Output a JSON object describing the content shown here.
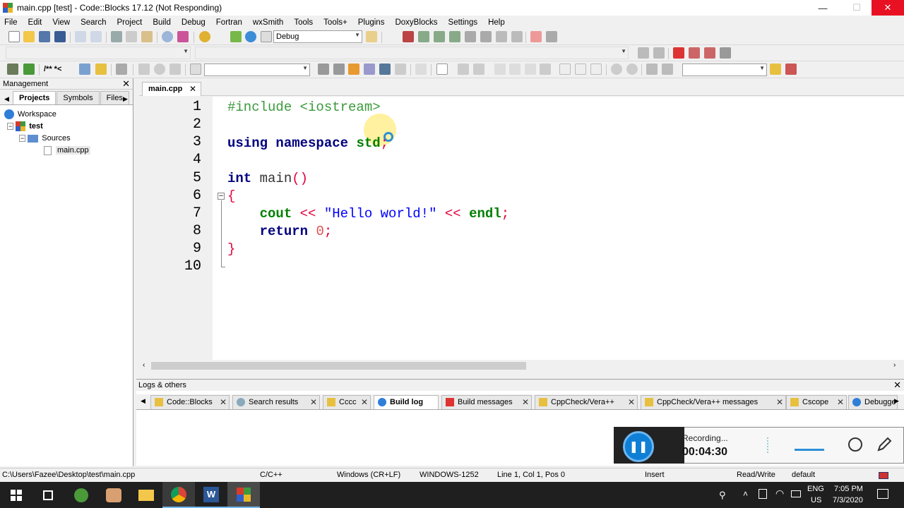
{
  "window": {
    "title": "main.cpp [test] - Code::Blocks 17.12 (Not Responding)",
    "minimize": "—",
    "maximize": "☐",
    "close": "✕"
  },
  "menu": [
    "File",
    "Edit",
    "View",
    "Search",
    "Project",
    "Build",
    "Debug",
    "Fortran",
    "wxSmith",
    "Tools",
    "Tools+",
    "Plugins",
    "DoxyBlocks",
    "Settings",
    "Help"
  ],
  "toolbar": {
    "build_target": "Debug",
    "comment_label": "/** *<"
  },
  "management": {
    "title": "Management",
    "tabs": [
      "Projects",
      "Symbols",
      "Files"
    ],
    "tree": {
      "workspace": "Workspace",
      "project": "test",
      "folder": "Sources",
      "file": "main.cpp"
    }
  },
  "editor": {
    "tab": "main.cpp",
    "line_numbers": [
      "1",
      "2",
      "3",
      "4",
      "5",
      "6",
      "7",
      "8",
      "9",
      "10"
    ],
    "code": {
      "l1": "#include <iostream>",
      "l3_kw": "using namespace",
      "l3_id": "std",
      "l3_semi": ";",
      "l5_kw": "int",
      "l5_fn": "main",
      "l5_par": "()",
      "l6": "{",
      "l7_cout": "cout",
      "l7_op1": "<<",
      "l7_str": "\"Hello world!\"",
      "l7_op2": "<<",
      "l7_endl": "endl",
      "l7_semi": ";",
      "l8_kw": "return",
      "l8_num": "0",
      "l8_semi": ";",
      "l9": "}"
    }
  },
  "logs": {
    "title": "Logs & others",
    "tabs": [
      "Code::Blocks",
      "Search results",
      "Cccc",
      "Build log",
      "Build messages",
      "CppCheck/Vera++",
      "CppCheck/Vera++ messages",
      "Cscope",
      "Debugge"
    ]
  },
  "recording": {
    "status": "Recording...",
    "time": "00:04:30"
  },
  "statusbar": {
    "path": "C:\\Users\\Fazee\\Desktop\\test\\main.cpp",
    "language": "C/C++",
    "eol": "Windows (CR+LF)",
    "encoding": "WINDOWS-1252",
    "position": "Line 1, Col 1, Pos 0",
    "mode": "Insert",
    "access": "Read/Write",
    "profile": "default"
  },
  "taskbar": {
    "lang1": "ENG",
    "lang2": "US",
    "time": "7:05 PM",
    "date": "7/3/2020"
  }
}
